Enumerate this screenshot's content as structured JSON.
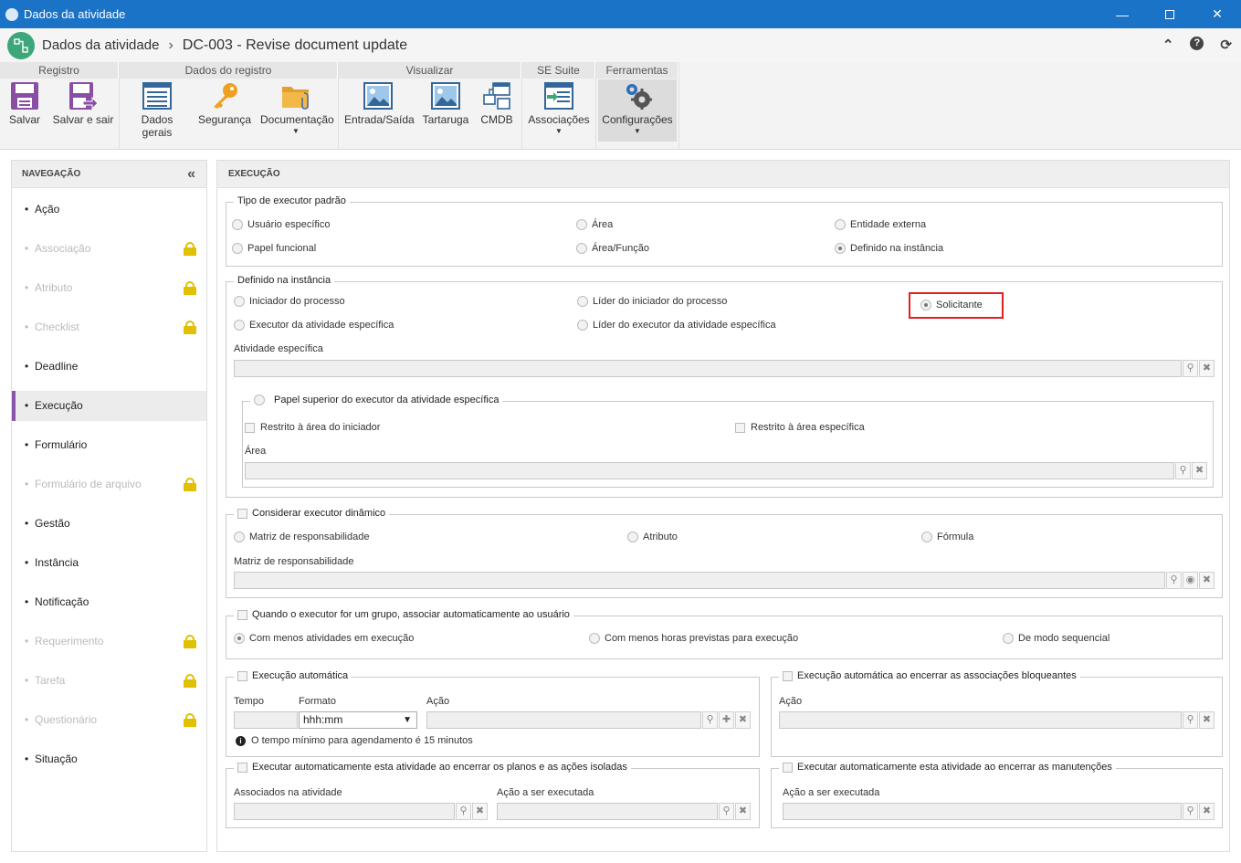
{
  "window": {
    "title": "Dados da atividade",
    "minimize_icon": "minimize-icon",
    "maximize_icon": "maximize-icon",
    "close_icon": "close-icon"
  },
  "header": {
    "breadcrumb_root": "Dados da atividade",
    "separator": "›",
    "breadcrumb_current": "DC-003 - Revise document update",
    "icons": [
      "collapse-up-icon",
      "help-icon",
      "refresh-icon"
    ]
  },
  "ribbon": {
    "groups": [
      {
        "label": "Registro",
        "buttons": [
          {
            "label": "Salvar",
            "icon": "save-icon"
          },
          {
            "label": "Salvar e sair",
            "icon": "save-exit-icon"
          }
        ]
      },
      {
        "label": "Dados do registro",
        "buttons": [
          {
            "label": "Dados gerais",
            "icon": "form-icon"
          },
          {
            "label": "Segurança",
            "icon": "key-icon"
          },
          {
            "label": "Documentação",
            "icon": "folder-icon",
            "dropdown": true
          }
        ]
      },
      {
        "label": "Visualizar",
        "buttons": [
          {
            "label": "Entrada/Saída",
            "icon": "image-icon"
          },
          {
            "label": "Tartaruga",
            "icon": "image-icon"
          },
          {
            "label": "CMDB",
            "icon": "cmdb-icon"
          }
        ]
      },
      {
        "label": "SE Suite",
        "buttons": [
          {
            "label": "Associações",
            "icon": "associations-icon",
            "dropdown": true
          }
        ]
      },
      {
        "label": "Ferramentas",
        "buttons": [
          {
            "label": "Configurações",
            "icon": "gears-icon",
            "dropdown": true,
            "active": true
          }
        ]
      }
    ]
  },
  "nav": {
    "title": "NAVEGAÇÃO",
    "collapse_icon": "double-chevron-left-icon",
    "items": [
      {
        "label": "Ação",
        "locked": false
      },
      {
        "label": "Associação",
        "locked": true
      },
      {
        "label": "Atributo",
        "locked": true
      },
      {
        "label": "Checklist",
        "locked": true
      },
      {
        "label": "Deadline",
        "locked": false
      },
      {
        "label": "Execução",
        "locked": false,
        "active": true
      },
      {
        "label": "Formulário",
        "locked": false
      },
      {
        "label": "Formulário de arquivo",
        "locked": true
      },
      {
        "label": "Gestão",
        "locked": false
      },
      {
        "label": "Instância",
        "locked": false
      },
      {
        "label": "Notificação",
        "locked": false
      },
      {
        "label": "Requerimento",
        "locked": true
      },
      {
        "label": "Tarefa",
        "locked": true
      },
      {
        "label": "Questionário",
        "locked": true
      },
      {
        "label": "Situação",
        "locked": false
      }
    ]
  },
  "main": {
    "title": "EXECUÇÃO",
    "tipo_executor": {
      "legend": "Tipo de executor padrão",
      "options": [
        "Usuário específico",
        "Área",
        "Entidade externa",
        "Papel funcional",
        "Área/Função",
        "Definido na instância"
      ],
      "selected": "Definido na instância"
    },
    "definido_instancia": {
      "legend": "Definido na instância",
      "options": [
        "Iniciador do processo",
        "Líder do iniciador do processo",
        "Solicitante",
        "Executor da atividade específica",
        "Líder do executor da atividade específica"
      ],
      "selected": "Solicitante",
      "atividade_label": "Atividade específica",
      "papel_superior": {
        "legend": "Papel superior do executor da atividade específica",
        "check1": "Restrito à área do iniciador",
        "check2": "Restrito à área específica",
        "area_label": "Área"
      }
    },
    "executor_dinamico": {
      "legend": "Considerar executor dinâmico",
      "options": [
        "Matriz de responsabilidade",
        "Atributo",
        "Fórmula"
      ],
      "field_label": "Matriz de responsabilidade"
    },
    "grupo": {
      "legend": "Quando o executor for um grupo, associar automaticamente ao usuário",
      "options": [
        "Com menos atividades em execução",
        "Com menos horas previstas para execução",
        "De modo sequencial"
      ],
      "selected": "Com menos atividades em execução"
    },
    "execucao_automatica": {
      "legend": "Execução automática",
      "tempo_label": "Tempo",
      "formato_label": "Formato",
      "formato_value": "hhh:mm",
      "acao_label": "Ação",
      "info": "O tempo mínimo para agendamento é 15 minutos"
    },
    "execucao_bloqueantes": {
      "legend": "Execução automática ao encerrar as associações bloqueantes",
      "acao_label": "Ação"
    },
    "executar_planos": {
      "legend": "Executar automaticamente esta atividade ao encerrar os planos e as ações isoladas",
      "associados_label": "Associados na atividade",
      "acao_label": "Ação a ser executada"
    },
    "executar_manutencoes": {
      "legend": "Executar automaticamente esta atividade ao encerrar as manutenções",
      "acao_label": "Ação a ser executada"
    }
  }
}
